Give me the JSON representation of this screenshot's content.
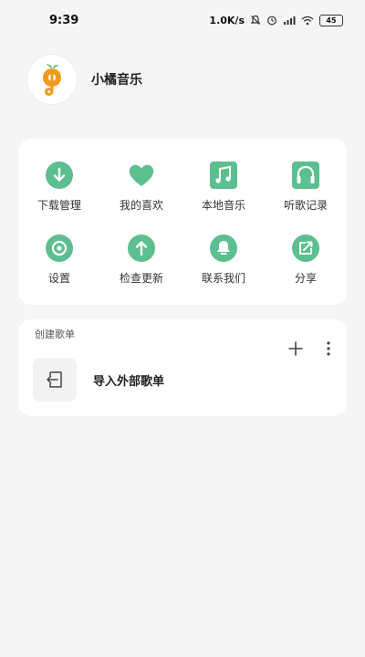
{
  "status_bar": {
    "time": "9:39",
    "speed": "1.0K/s",
    "battery": "45",
    "icons": [
      "mute-icon",
      "alarm-icon",
      "signal-icon",
      "wifi-icon",
      "battery-icon"
    ]
  },
  "profile": {
    "app_name": "小橘音乐",
    "avatar_icon": "orange-music-logo"
  },
  "menu": {
    "accent": "#5cbf8f",
    "items": [
      {
        "label": "下载管理",
        "icon": "download-icon"
      },
      {
        "label": "我的喜欢",
        "icon": "heart-icon"
      },
      {
        "label": "本地音乐",
        "icon": "music-note-icon"
      },
      {
        "label": "听歌记录",
        "icon": "headphones-icon"
      },
      {
        "label": "设置",
        "icon": "settings-icon"
      },
      {
        "label": "检查更新",
        "icon": "update-icon"
      },
      {
        "label": "联系我们",
        "icon": "contact-icon"
      },
      {
        "label": "分享",
        "icon": "share-icon"
      }
    ]
  },
  "playlist": {
    "title": "创建歌单",
    "add_icon": "plus-icon",
    "more_icon": "more-vertical-icon",
    "import_label": "导入外部歌单",
    "import_icon": "import-icon"
  }
}
